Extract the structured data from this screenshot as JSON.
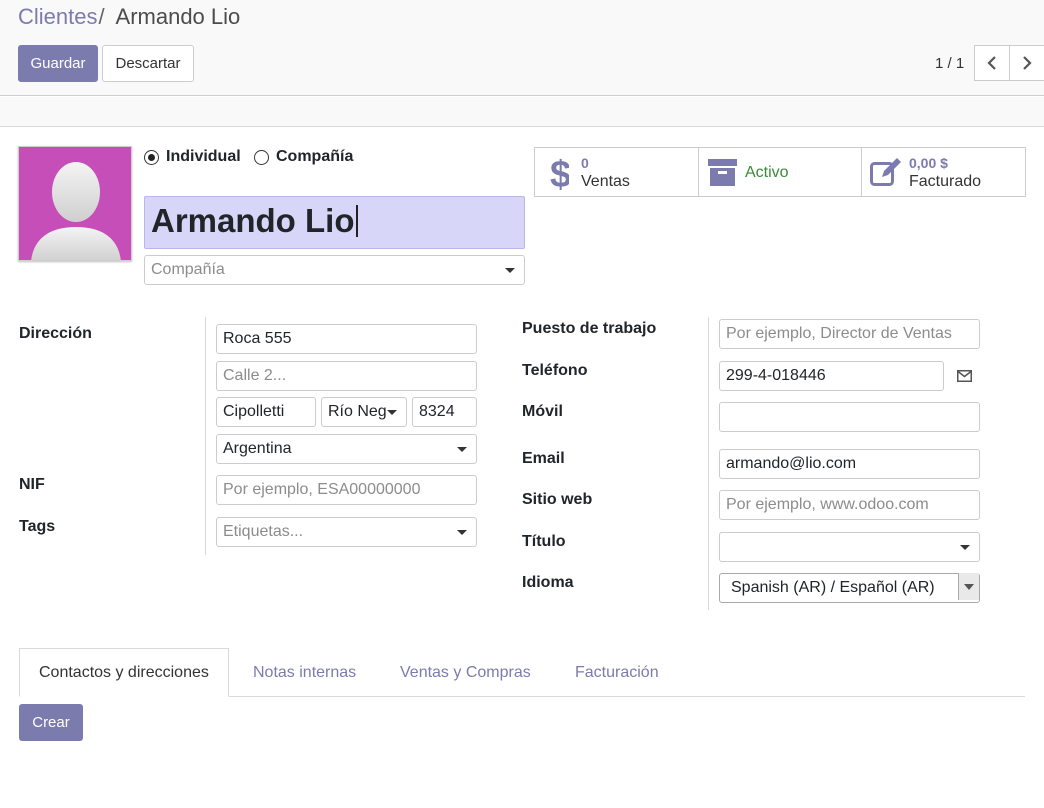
{
  "breadcrumb": {
    "parent": "Clientes",
    "separator": "/",
    "current": "Armando Lio"
  },
  "toolbar": {
    "save_label": "Guardar",
    "discard_label": "Descartar"
  },
  "pager": {
    "value": "1 / 1"
  },
  "company_type": {
    "individual_label": "Individual",
    "company_label": "Compañía",
    "selected": "Individual"
  },
  "partner": {
    "name": "Armando Lio",
    "company_placeholder": "Compañía"
  },
  "stats": {
    "sales": {
      "count": "0",
      "label": "Ventas"
    },
    "active": {
      "label": "Activo"
    },
    "invoiced": {
      "amount": "0,00 $",
      "label": "Facturado"
    }
  },
  "labels": {
    "address": "Dirección",
    "vat": "NIF",
    "tags": "Tags",
    "function": "Puesto de trabajo",
    "phone": "Teléfono",
    "mobile": "Móvil",
    "email": "Email",
    "website": "Sitio web",
    "title": "Título",
    "language": "Idioma"
  },
  "address": {
    "street": "Roca 555",
    "street2_placeholder": "Calle 2...",
    "city": "Cipolletti",
    "state": "Río Neg",
    "zip": "8324",
    "country": "Argentina"
  },
  "fields": {
    "vat_placeholder": "Por ejemplo, ESA00000000",
    "tags_placeholder": "Etiquetas...",
    "function_placeholder": "Por ejemplo, Director de Ventas",
    "phone": "299-4-018446",
    "mobile": "",
    "email": "armando@lio.com",
    "website_placeholder": "Por ejemplo, www.odoo.com",
    "title": "",
    "language": "Spanish (AR) / Español (AR)"
  },
  "tabs": [
    {
      "label": "Contactos y direcciones",
      "active": true
    },
    {
      "label": "Notas internas",
      "active": false
    },
    {
      "label": "Ventas y Compras",
      "active": false
    },
    {
      "label": "Facturación",
      "active": false
    }
  ],
  "create_label": "Crear",
  "colors": {
    "primary": "#7c7bad",
    "avatar_bg": "#c64eb8",
    "active_green": "#3c8a3a",
    "name_highlight": "#d7d6f9"
  },
  "icons": [
    "chevron-left-icon",
    "chevron-right-icon",
    "dollar-icon",
    "archive-icon",
    "edit-icon",
    "envelope-icon",
    "caret-down-icon"
  ]
}
